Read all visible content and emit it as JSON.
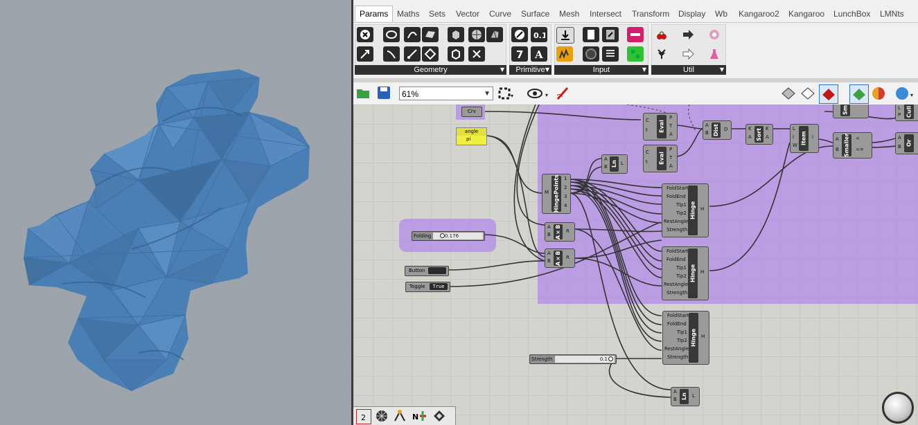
{
  "tabs": [
    "Params",
    "Maths",
    "Sets",
    "Vector",
    "Curve",
    "Surface",
    "Mesh",
    "Intersect",
    "Transform",
    "Display",
    "Wb",
    "Kangaroo2",
    "Kangaroo",
    "LunchBox",
    "LMNts"
  ],
  "panels": {
    "geometry": "Geometry",
    "primitive": "Primitive",
    "input": "Input",
    "util": "Util"
  },
  "icons": {
    "geometry": [
      "point-icon",
      "circle-icon",
      "curve-icon",
      "surface-icon",
      "box-icon",
      "brep-icon",
      "mesh-icon",
      "vector-icon",
      "arc-icon",
      "line-icon",
      "plane-icon",
      "group-icon"
    ],
    "primitive": [
      "boolean-icon",
      "number-icon",
      "integer-icon",
      "text-icon"
    ],
    "input": [
      "data-input-icon",
      "panel-icon",
      "value-list-icon",
      "gradient-icon",
      "graph-mapper-icon",
      "dial-icon",
      "list-icon",
      "image-sampler-icon"
    ],
    "util": [
      "cherry-picker-icon",
      "relay-icon",
      "cluster-icon",
      "tree-icon",
      "arrow-icon",
      "flask-icon"
    ]
  },
  "toolbar": {
    "zoom": "61%"
  },
  "colors": {
    "group": "#a878f0",
    "mesh": "#4a7fb5",
    "background": "#9ea4ab",
    "canvas": "#d4d4cf"
  },
  "canvas": {
    "crv_label": "Crv",
    "angle": {
      "name": "angle",
      "value": "pi"
    },
    "folding": {
      "name": "Folding",
      "value": "0.176"
    },
    "button": "Button",
    "toggle": {
      "name": "Toggle",
      "value": "True"
    },
    "strength": {
      "name": "Strength",
      "value": "0.1"
    },
    "components": {
      "hingepoints": {
        "name": "HingePoints",
        "input": "M",
        "outputs": [
          "1",
          "2",
          "3",
          "4"
        ]
      },
      "ln_top": {
        "name": "Ln",
        "inputs": [
          "A",
          "B"
        ],
        "output": "L"
      },
      "ln_bottom": {
        "name": "Ln",
        "inputs": [
          "A",
          "B"
        ],
        "output": "L"
      },
      "eval_top": {
        "name": "Eval",
        "inputs": [
          "C",
          "t"
        ],
        "outputs": [
          "P",
          "T",
          "A"
        ]
      },
      "eval_mid": {
        "name": "Eval",
        "inputs": [
          "C",
          "t"
        ],
        "outputs": [
          "P",
          "T",
          "A"
        ]
      },
      "dist": {
        "name": "Dist",
        "inputs": [
          "A",
          "B"
        ],
        "output": "D"
      },
      "sort": {
        "name": "Sort",
        "inputs": [
          "K",
          "A"
        ],
        "outputs": [
          "K",
          "A"
        ]
      },
      "item": {
        "name": "Item",
        "inputs": [
          "L",
          "i",
          "W"
        ],
        "output": "i"
      },
      "smaller": {
        "name": "Smaller",
        "inputs": [
          "A",
          "B"
        ],
        "outputs": [
          "<",
          "<="
        ]
      },
      "or": {
        "name": "Or",
        "inputs": [
          "A",
          "B"
        ],
        "output": "R"
      },
      "cull": {
        "name": "Cull",
        "inputs": [
          "L",
          "P"
        ],
        "output": "L"
      },
      "sm": {
        "name": "Sm"
      },
      "axb1": {
        "name": "A×B",
        "inputs": [
          "A",
          "B"
        ],
        "output": "R"
      },
      "axb2": {
        "name": "A×B",
        "inputs": [
          "A",
          "B"
        ],
        "output": "R"
      },
      "hinge": {
        "name": "Hinge",
        "inputs": [
          "FoldStart",
          "FoldEnd",
          "Tip1",
          "Tip2",
          "RestAngle",
          "Strength"
        ],
        "output": "H"
      }
    }
  },
  "bottom_bar": [
    "sketch-icon",
    "mesh-explode-icon",
    "grab-icon",
    "network-icon",
    "cube-icon"
  ]
}
